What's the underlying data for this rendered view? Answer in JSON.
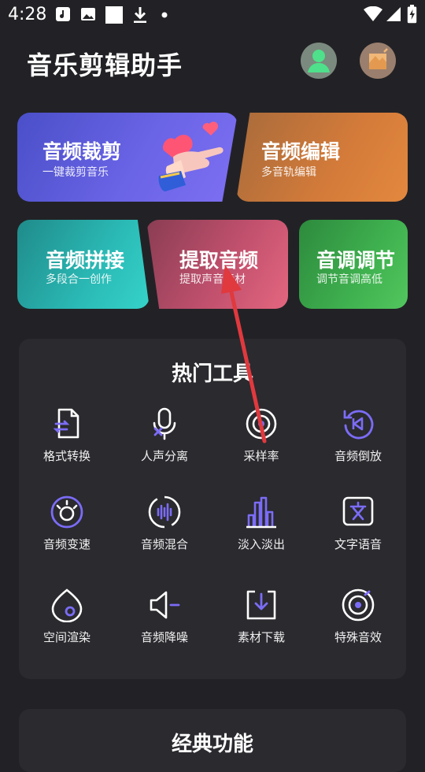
{
  "status_bar": {
    "time": "4:28"
  },
  "header": {
    "title": "音乐剪辑助手"
  },
  "feature_cards": [
    {
      "title": "音频裁剪",
      "subtitle": "一键裁剪音乐"
    },
    {
      "title": "音频编辑",
      "subtitle": "多音轨编辑"
    },
    {
      "title": "音频拼接",
      "subtitle": "多段合一创作"
    },
    {
      "title": "提取音频",
      "subtitle": "提取声音素材"
    },
    {
      "title": "音调调节",
      "subtitle": "调节音调高低"
    }
  ],
  "hot_tools": {
    "title": "热门工具",
    "items": [
      {
        "label": "格式转换",
        "icon": "file-convert-icon"
      },
      {
        "label": "人声分离",
        "icon": "microphone-icon"
      },
      {
        "label": "采样率",
        "icon": "sample-rate-icon"
      },
      {
        "label": "音频倒放",
        "icon": "reverse-play-icon"
      },
      {
        "label": "音频变速",
        "icon": "speed-icon"
      },
      {
        "label": "音频混合",
        "icon": "mix-icon"
      },
      {
        "label": "淡入淡出",
        "icon": "fade-icon"
      },
      {
        "label": "文字语音",
        "icon": "text-to-speech-icon"
      },
      {
        "label": "空间渲染",
        "icon": "spatial-icon"
      },
      {
        "label": "音频降噪",
        "icon": "denoise-icon"
      },
      {
        "label": "素材下载",
        "icon": "download-icon"
      },
      {
        "label": "特殊音效",
        "icon": "special-effect-icon"
      }
    ]
  },
  "classic": {
    "title": "经典功能"
  },
  "colors": {
    "accent": "#7b6cf6",
    "background": "#222226",
    "panel": "#2a2a2f",
    "annotation_arrow": "#e0393e"
  }
}
